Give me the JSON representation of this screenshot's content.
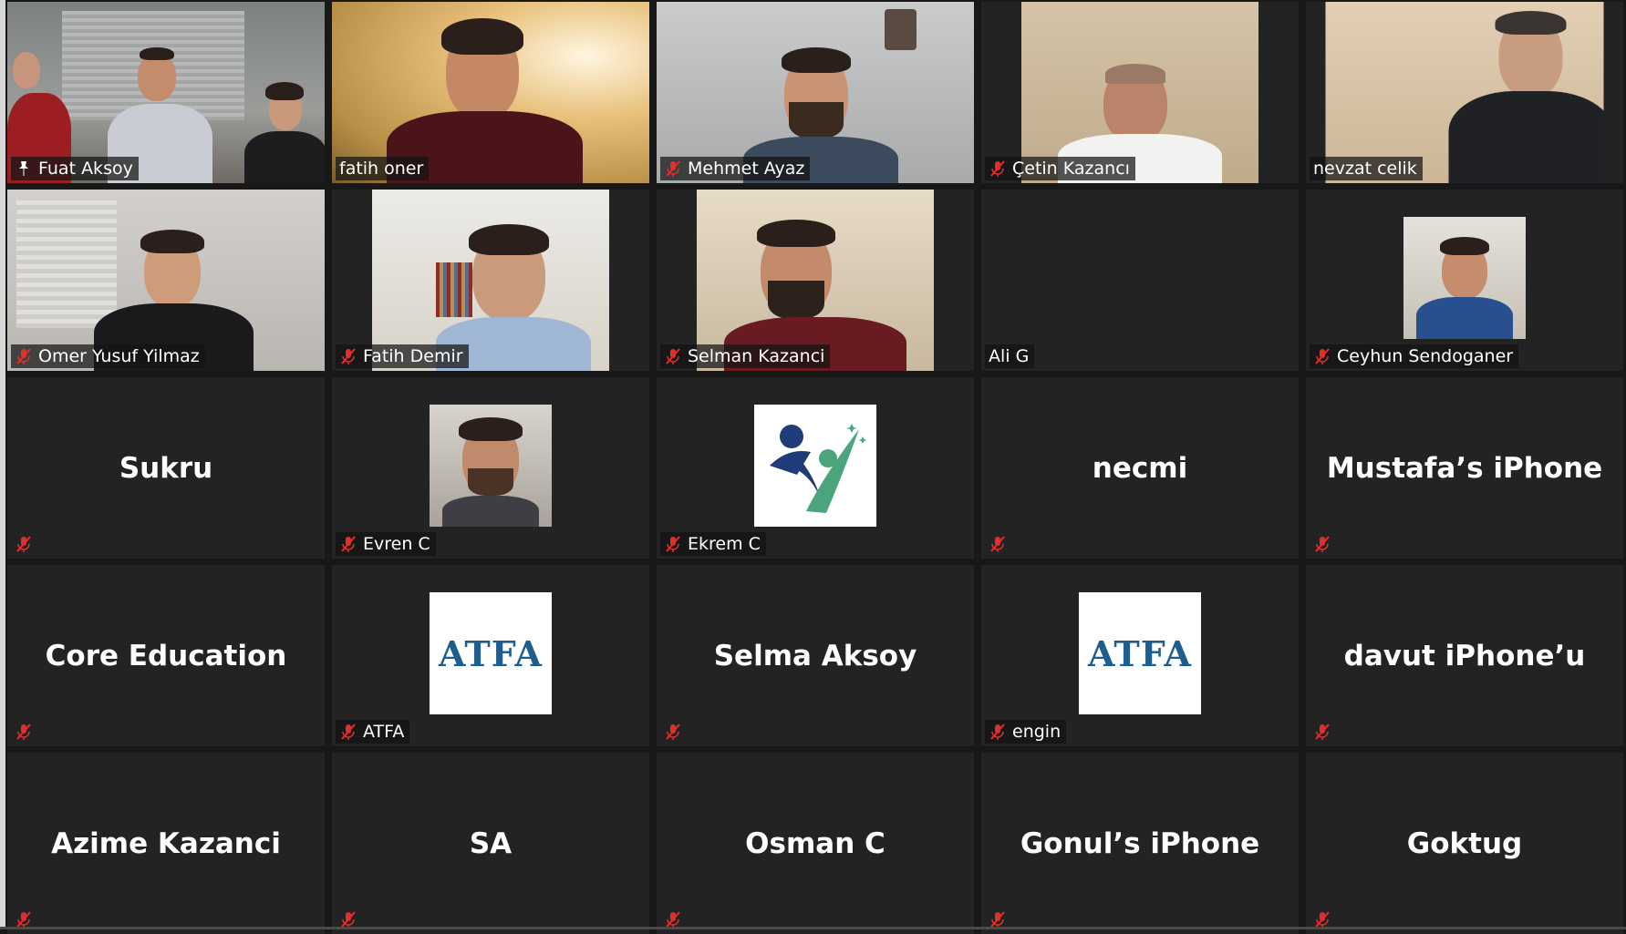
{
  "participants": [
    {
      "name": "Fuat Aksoy",
      "type": "video",
      "active": true,
      "pinned": true,
      "bg": "#8a8c8a"
    },
    {
      "name": "fatih oner",
      "type": "video",
      "bg": "#d9b46a"
    },
    {
      "name": "Mehmet Ayaz",
      "type": "video",
      "muted": true,
      "bg": "#bdbfc0"
    },
    {
      "name": "Çetin Kazancı",
      "type": "video",
      "muted": true,
      "bg": "#c9b79d"
    },
    {
      "name": "nevzat celik",
      "type": "video",
      "bg": "#d8c3a5"
    },
    {
      "name": "Omer Yusuf Yilmaz",
      "type": "video",
      "muted": true,
      "bg": "#cfcdcb"
    },
    {
      "name": "Fatih Demir",
      "type": "video",
      "muted": true,
      "bg": "#e1dcd4"
    },
    {
      "name": "Selman Kazanci",
      "type": "video",
      "muted": true,
      "bg": "#d2c6b3"
    },
    {
      "name": "Ali G",
      "type": "blank"
    },
    {
      "name": "Ceyhun Sendoganer",
      "type": "photo",
      "muted": true
    },
    {
      "name": "Sukru",
      "type": "text",
      "muted": true
    },
    {
      "name": "Evren C",
      "type": "photo",
      "muted": true
    },
    {
      "name": "Ekrem C",
      "type": "logo-figure",
      "muted": true
    },
    {
      "name": "necmi",
      "type": "text",
      "muted": true
    },
    {
      "name": "Mustafa’s iPhone",
      "type": "text",
      "muted": true
    },
    {
      "name": "Core Education",
      "type": "text",
      "muted": true
    },
    {
      "name": "ATFA",
      "type": "logo-atfa",
      "muted": true,
      "logo_text": "ATFA"
    },
    {
      "name": "Selma Aksoy",
      "type": "text",
      "muted": true
    },
    {
      "name": "engin",
      "type": "logo-atfa",
      "muted": true,
      "logo_text": "ATFA"
    },
    {
      "name": "davut iPhone’u",
      "type": "text",
      "muted": true
    },
    {
      "name": "Azime Kazanci",
      "type": "text",
      "muted": true
    },
    {
      "name": "SA",
      "type": "text",
      "muted": true
    },
    {
      "name": "Osman C",
      "type": "text",
      "muted": true
    },
    {
      "name": "Gonul’s iPhone",
      "type": "text",
      "muted": true
    },
    {
      "name": "Goktug",
      "type": "text",
      "muted": true
    }
  ],
  "colors": {
    "active_border": "#b3de3a",
    "muted_icon": "#e0302c",
    "tile_bg": "#232323"
  },
  "icons": {
    "muted": "mic-muted-icon",
    "pinned": "pin-icon"
  }
}
